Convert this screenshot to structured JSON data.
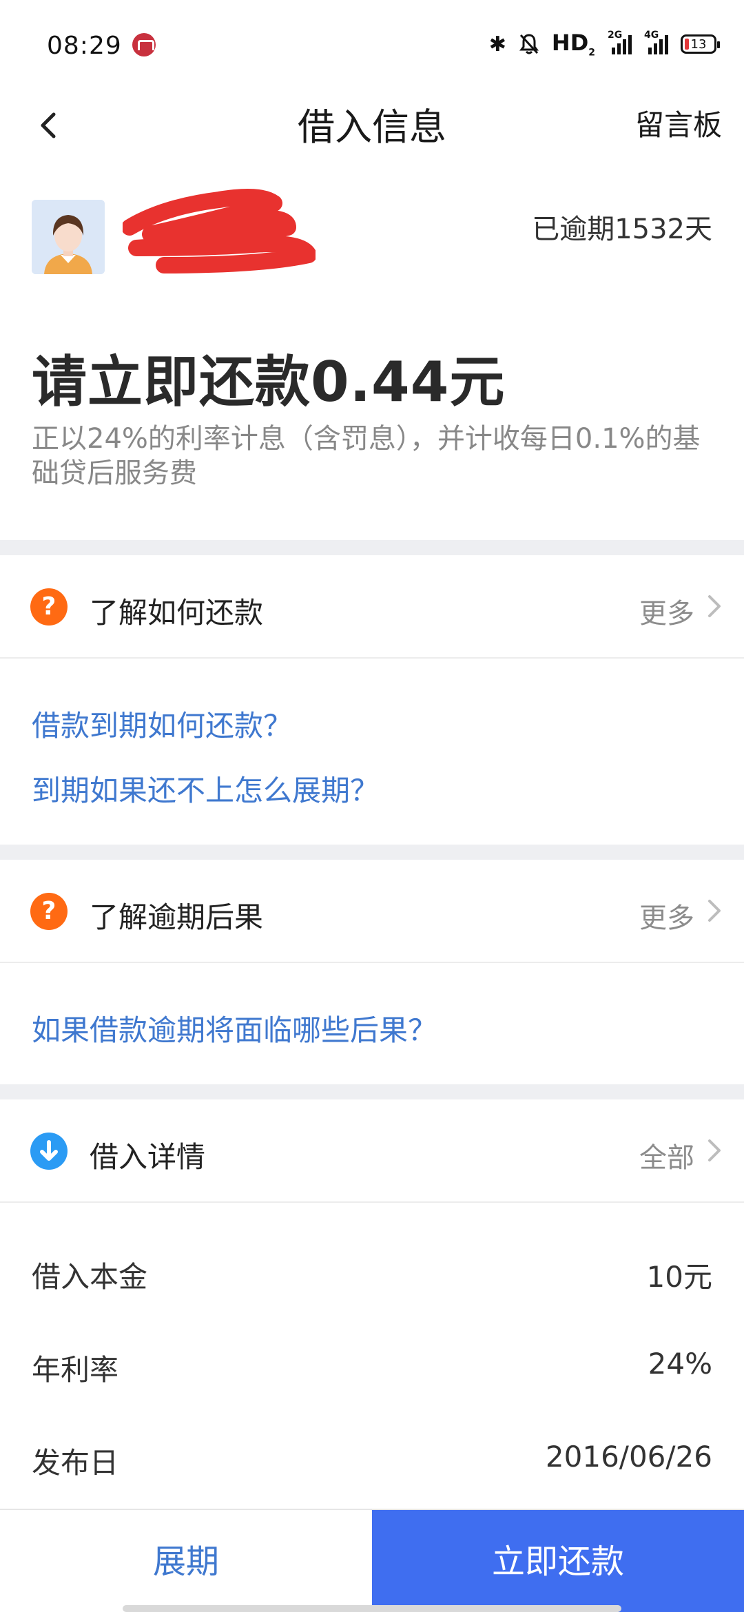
{
  "status_bar": {
    "time": "08:29",
    "hd_label": "HD",
    "hd_sub": "2",
    "sig1_label": "2G",
    "sig2_label": "4G",
    "battery": "13"
  },
  "header": {
    "title": "借入信息",
    "right_action": "留言板"
  },
  "user": {
    "overdue": "已逾期1532天"
  },
  "summary": {
    "amount_text": "请立即还款0.44元",
    "note": "正以24%的利率计息（含罚息），并计收每日0.1%的基础贷后服务费"
  },
  "sections": {
    "how_to_repay": {
      "title": "了解如何还款",
      "more": "更多",
      "links": [
        "借款到期如何还款？",
        "到期如果还不上怎么展期？"
      ]
    },
    "overdue_consequence": {
      "title": "了解逾期后果",
      "more": "更多",
      "links": [
        "如果借款逾期将面临哪些后果？"
      ]
    },
    "details": {
      "title": "借入详情",
      "more": "全部",
      "rows": [
        {
          "label": "借入本金",
          "value": "10元"
        },
        {
          "label": "年利率",
          "value": "24%"
        },
        {
          "label": "发布日",
          "value": "2016/06/26"
        }
      ]
    }
  },
  "bottom": {
    "extend": "展期",
    "repay": "立即还款"
  },
  "colors": {
    "accent_blue": "#3f6ef0",
    "link_blue": "#3f78cf",
    "question_orange": "#ff6a13",
    "download_blue": "#2b9bf4",
    "redaction_red": "#e8322f"
  }
}
